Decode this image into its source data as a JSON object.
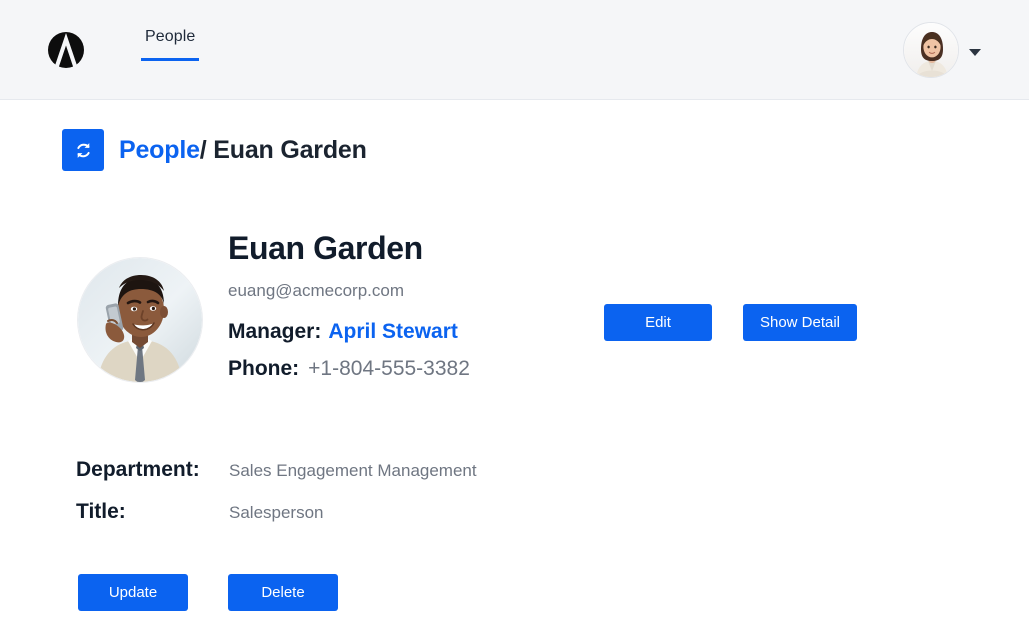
{
  "colors": {
    "accent": "#0b63f0",
    "header_bg": "#f5f6f8",
    "text_dark": "#111c2b",
    "text_muted": "#6f7682",
    "page_bg": "#ffffff"
  },
  "header": {
    "logo_name": "acme-logo",
    "tabs": [
      {
        "label": "People",
        "active": true
      }
    ],
    "account": {
      "avatar_name": "user-avatar",
      "caret_name": "chevron-down-icon"
    }
  },
  "breadcrumb": {
    "refresh_icon": "refresh-icon",
    "parent": "People",
    "separator": "/",
    "current": "Euan Garden"
  },
  "profile": {
    "photo_name": "person-photo",
    "name": "Euan Garden",
    "email": "euang@acmecorp.com",
    "manager_label": "Manager:",
    "manager_value": "April Stewart",
    "phone_label": "Phone:",
    "phone_value": "+1-804-555-3382"
  },
  "actions": {
    "edit_label": "Edit",
    "show_detail_label": "Show Detail"
  },
  "details": {
    "rows": [
      {
        "label": "Department:",
        "value": "Sales Engagement Management"
      },
      {
        "label": "Title:",
        "value": "Salesperson"
      }
    ]
  },
  "footer_actions": {
    "update_label": "Update",
    "delete_label": "Delete"
  }
}
